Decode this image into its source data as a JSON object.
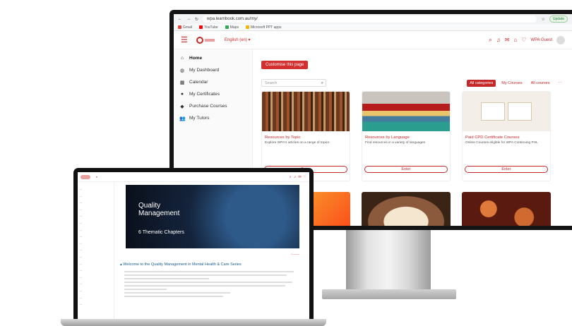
{
  "monitor": {
    "browser": {
      "url": "wpa.learnbook.com.au/my/",
      "update_label": "Update",
      "bookmarks": [
        {
          "label": "Gmail",
          "color": "#ea4335"
        },
        {
          "label": "YouTube",
          "color": "#ff0000"
        },
        {
          "label": "Maps",
          "color": "#34a853"
        },
        {
          "label": "Microsoft PPT apps",
          "color": "#f4b400"
        }
      ]
    },
    "header": {
      "language": "English (en) ▾",
      "user": "WPA Guest"
    },
    "sidebar": [
      {
        "label": "Home",
        "icon": "home-icon",
        "glyph": "⌂"
      },
      {
        "label": "My Dashboard",
        "icon": "dashboard-icon",
        "glyph": "◍"
      },
      {
        "label": "Calendar",
        "icon": "calendar-icon",
        "glyph": "▦"
      },
      {
        "label": "My Certificates",
        "icon": "certificate-icon",
        "glyph": "●"
      },
      {
        "label": "Purchase Courses",
        "icon": "tag-icon",
        "glyph": "◆"
      },
      {
        "label": "My Tutors",
        "icon": "users-icon",
        "glyph": "👥"
      }
    ],
    "main": {
      "customise_button": "Customise this page",
      "search_placeholder": "Search",
      "filters": [
        "All categories",
        "My Courses",
        "All courses"
      ],
      "cards": [
        {
          "title": "Resources by Topic",
          "desc": "Explore WPA's articles on a range of topics",
          "enter": "Enter"
        },
        {
          "title": "Resources by Language",
          "desc": "Find resources in a variety of languages",
          "enter": "Enter"
        },
        {
          "title": "Paid CPD Certificate Courses",
          "desc": "Online Courses eligible for WPA Continuing PHL",
          "enter": "Enter"
        }
      ]
    }
  },
  "laptop": {
    "banner": {
      "title": "Quality Management",
      "subtitle": "6 Thematic Chapters"
    },
    "welcome": "Welcome to the Quality Management in Mental Health & Care Series"
  }
}
